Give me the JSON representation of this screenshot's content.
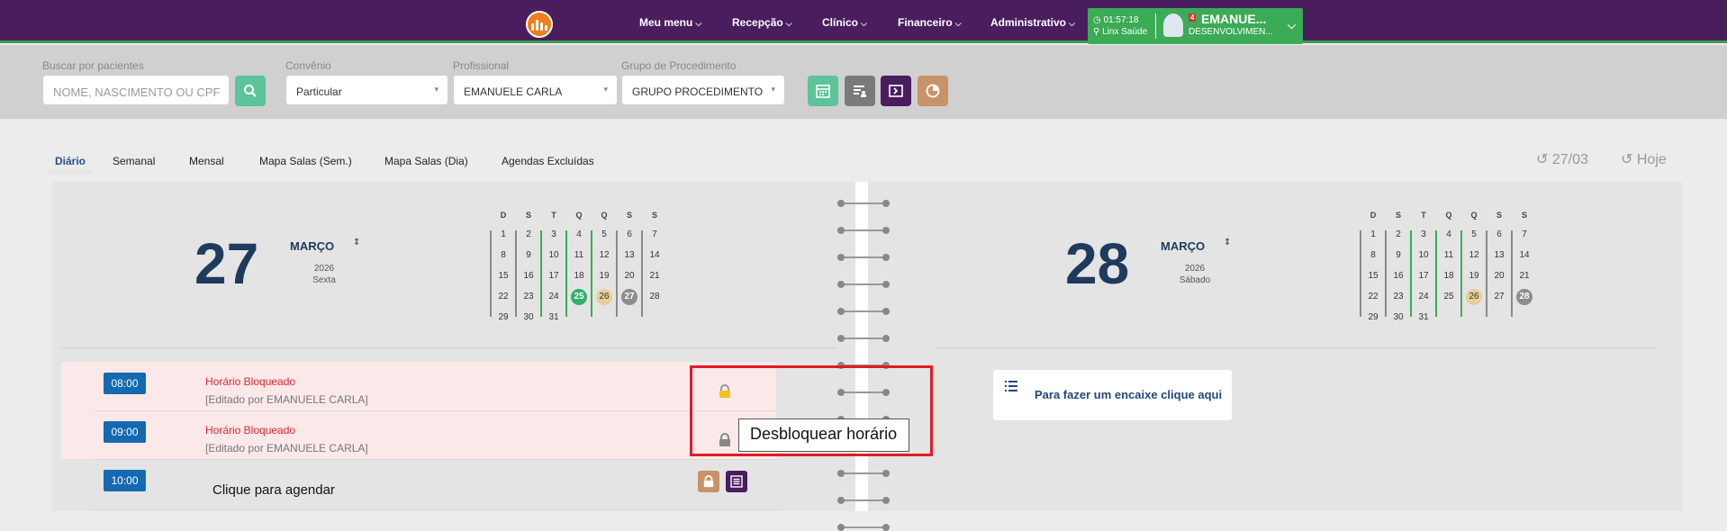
{
  "topbar": {
    "menu": [
      {
        "label": "Meu menu",
        "name": "meu-menu"
      },
      {
        "label": "Recepção",
        "name": "recepcao"
      },
      {
        "label": "Clínico",
        "name": "clinico"
      },
      {
        "label": "Financeiro",
        "name": "financeiro"
      },
      {
        "label": "Administrativo",
        "name": "administrativo"
      }
    ],
    "time": "01:57:18",
    "company": "Linx Saúde",
    "notification_count": "4",
    "user_name": "EMANUE...",
    "user_sub": "DESENVOLVIMEN..."
  },
  "filters": {
    "search_label": "Buscar por pacientes",
    "search_placeholder": "NOME, NASCIMENTO OU CPF",
    "convenio_label": "Convênio",
    "convenio_value": "Particular",
    "profissional_label": "Profissional",
    "profissional_value": "EMANUELE CARLA",
    "grupo_label": "Grupo de Procedimento",
    "grupo_value": "GRUPO PROCEDIMENTO"
  },
  "tabs": [
    "Diário",
    "Semanal",
    "Mensal",
    "Mapa Salas (Sem.)",
    "Mapa Salas (Dia)",
    "Agendas Excluídas"
  ],
  "top_right": {
    "prev_date": "27/03",
    "today": "Hoje"
  },
  "days": [
    {
      "day": "27",
      "month": "MARÇO",
      "year": "2026",
      "weekday": "Sexta"
    },
    {
      "day": "28",
      "month": "MARÇO",
      "year": "2026",
      "weekday": "Sábado"
    }
  ],
  "calendar": {
    "headers": [
      "D",
      "S",
      "T",
      "Q",
      "Q",
      "S",
      "S"
    ],
    "weeks": [
      [
        "1",
        "2",
        "3",
        "4",
        "5",
        "6",
        "7"
      ],
      [
        "8",
        "9",
        "10",
        "11",
        "12",
        "13",
        "14"
      ],
      [
        "15",
        "16",
        "17",
        "18",
        "19",
        "20",
        "21"
      ],
      [
        "22",
        "23",
        "24",
        "25",
        "26",
        "27",
        "28"
      ],
      [
        "29",
        "30",
        "31",
        "",
        "",
        "",
        ""
      ]
    ]
  },
  "slots": [
    {
      "time": "08:00",
      "title": "Horário Bloqueado",
      "edited": "[Editado por EMANUELE CARLA]"
    },
    {
      "time": "09:00",
      "title": "Horário Bloqueado",
      "edited": "[Editado por EMANUELE CARLA]"
    },
    {
      "time": "10:00",
      "text": "Clique para agendar"
    }
  ],
  "tooltip": "Desbloquear horário",
  "encaixe": "Para fazer um encaixe clique aqui",
  "colors": {
    "header": "#4a1d5e",
    "accent_green": "#3bab56",
    "time_badge": "#1469b0",
    "blocked_text": "#e0282e",
    "highlight_box": "#e01b24"
  }
}
